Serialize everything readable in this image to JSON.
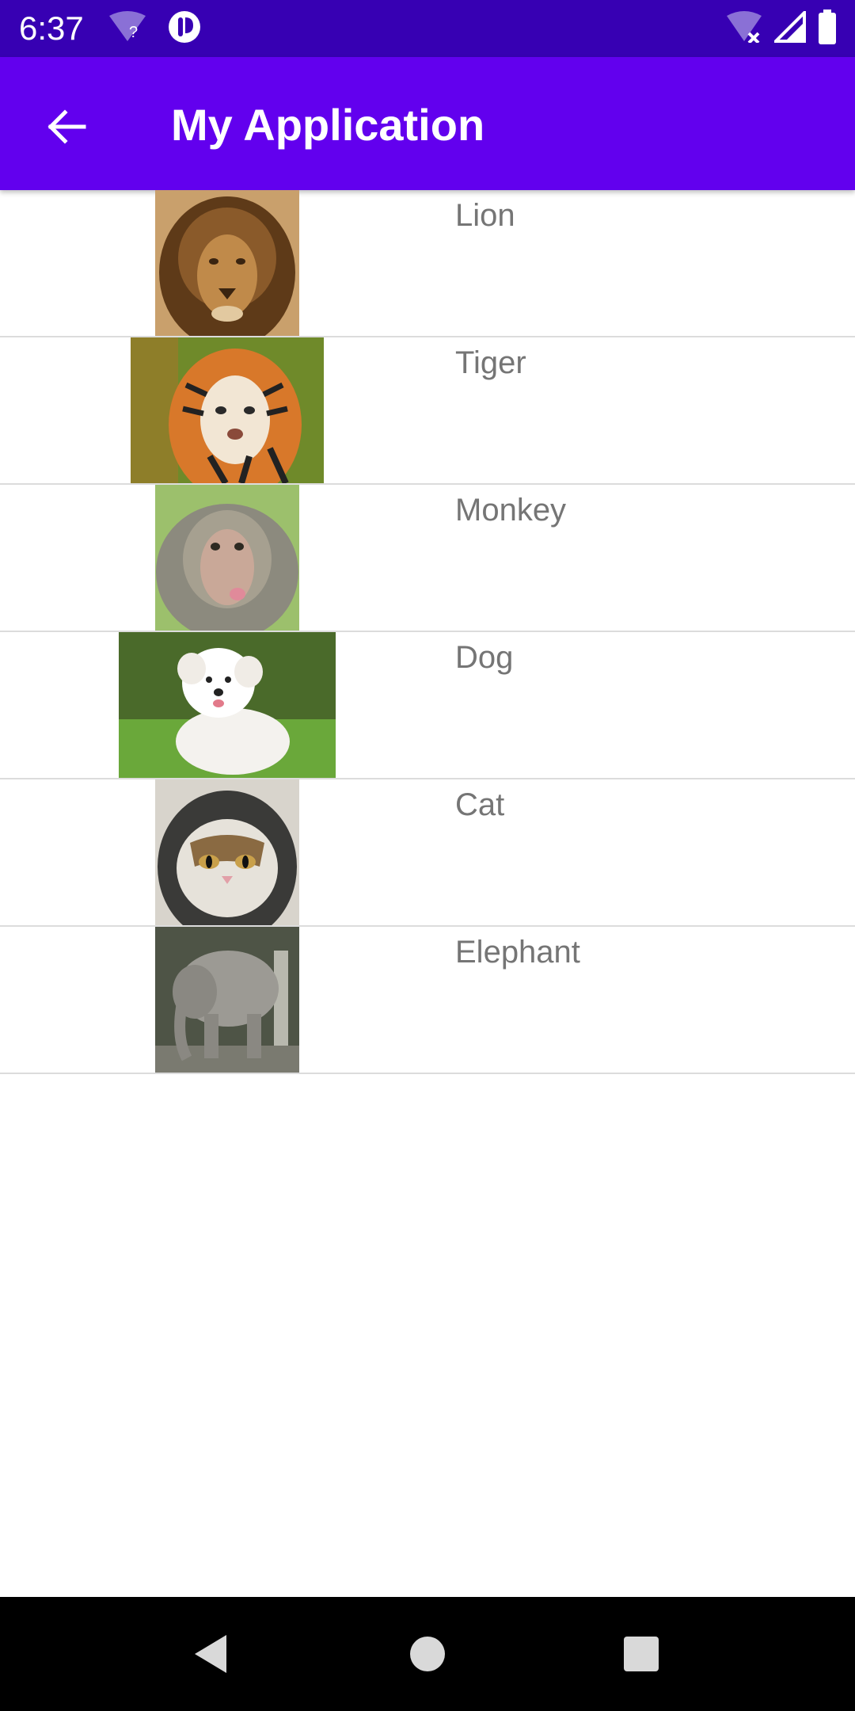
{
  "status_bar": {
    "time": "6:37",
    "icons_left": [
      "wifi-unknown-icon",
      "app-notification-icon"
    ],
    "icons_right": [
      "wifi-off-icon",
      "signal-icon",
      "battery-icon"
    ]
  },
  "app_bar": {
    "title": "My Application",
    "back_icon": "arrow-back-icon",
    "color": "#6200ee",
    "status_color": "#3700b3"
  },
  "animals": [
    {
      "name": "Lion",
      "image": "lion-photo"
    },
    {
      "name": "Tiger",
      "image": "tiger-photo"
    },
    {
      "name": "Monkey",
      "image": "monkey-photo"
    },
    {
      "name": "Dog",
      "image": "dog-photo"
    },
    {
      "name": "Cat",
      "image": "cat-photo"
    },
    {
      "name": "Elephant",
      "image": "elephant-photo"
    }
  ],
  "nav_bar": {
    "buttons": [
      "back-triangle-icon",
      "home-circle-icon",
      "recents-square-icon"
    ]
  }
}
